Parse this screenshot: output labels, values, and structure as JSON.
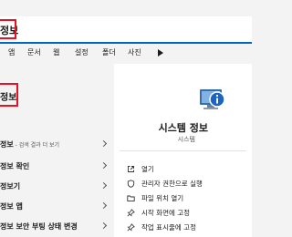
{
  "search": {
    "query": "정보"
  },
  "tabs": [
    {
      "label": "앱"
    },
    {
      "label": "문서"
    },
    {
      "label": "웹"
    },
    {
      "label": "설정"
    },
    {
      "label": "폴더"
    },
    {
      "label": "사진"
    }
  ],
  "best_match": {
    "label": "정보"
  },
  "results": [
    {
      "label": "정보",
      "sub": " - 검색 결과 더 보기"
    },
    {
      "label": "정보 확인",
      "sub": ""
    },
    {
      "label": "정보기",
      "sub": ""
    },
    {
      "label": "정보 앱",
      "sub": ""
    },
    {
      "label": "정보 보안 부팅 상태 변경",
      "sub": ""
    }
  ],
  "detail": {
    "title": "시스템 정보",
    "subtitle": "시스템",
    "actions": [
      {
        "label": "열기",
        "icon": "open-icon"
      },
      {
        "label": "관리자 권한으로 실행",
        "icon": "shield-icon"
      },
      {
        "label": "파일 위치 열기",
        "icon": "folder-icon"
      },
      {
        "label": "시작 화면에 고정",
        "icon": "pin-icon"
      },
      {
        "label": "작업 표시줄에 고정",
        "icon": "pin-icon"
      }
    ]
  },
  "colors": {
    "accent": "#0067c0",
    "highlight": "#e81123"
  }
}
